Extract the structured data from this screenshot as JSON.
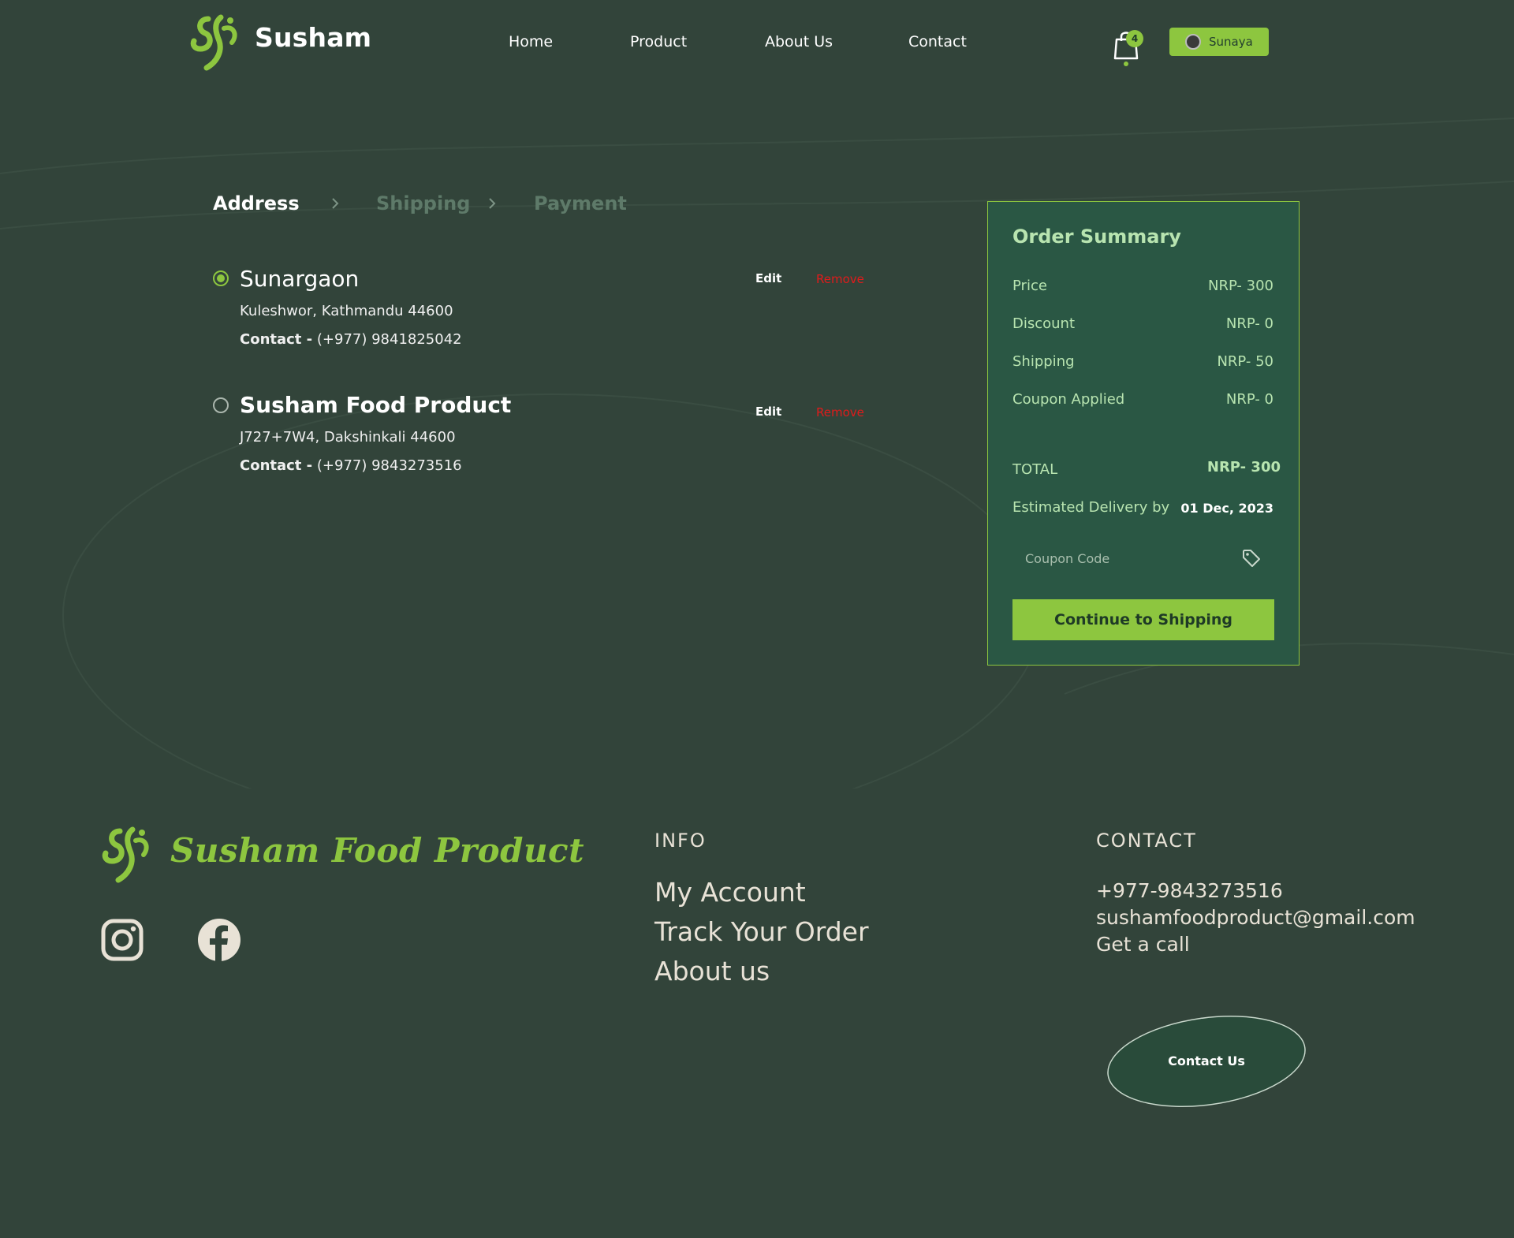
{
  "header": {
    "brand": "Susham",
    "nav": [
      "Home",
      "Product",
      "About Us",
      "Contact"
    ],
    "cart_count": "4",
    "cart_icon": "shopping-bag-icon",
    "user_name": "Sunaya"
  },
  "steps": [
    {
      "label": "Address",
      "active": true
    },
    {
      "label": "Shipping",
      "active": false
    },
    {
      "label": "Payment",
      "active": false
    }
  ],
  "addresses": [
    {
      "name": "Sunargaon",
      "line": "Kuleshwor, Kathmandu 44600",
      "contact_label": "Contact -",
      "contact_value": "(+977) 9841825042",
      "selected": true,
      "edit": "Edit",
      "remove": "Remove"
    },
    {
      "name": "Susham Food Product",
      "line": "J727+7W4, Dakshinkali 44600",
      "contact_label": "Contact -",
      "contact_value": "(+977) 9843273516",
      "selected": false,
      "edit": "Edit",
      "remove": "Remove"
    }
  ],
  "summary": {
    "title": "Order Summary",
    "rows": [
      {
        "label": "Price",
        "value": "NRP- 300"
      },
      {
        "label": "Discount",
        "value": "NRP- 0"
      },
      {
        "label": "Shipping",
        "value": "NRP- 50"
      },
      {
        "label": "Coupon Applied",
        "value": "NRP- 0"
      }
    ],
    "total_label": "TOTAL",
    "total_value": "NRP- 300",
    "delivery_label": "Estimated Delivery by",
    "delivery_value": "01 Dec, 2023",
    "coupon_placeholder": "Coupon Code",
    "continue_label": "Continue to Shipping"
  },
  "footer": {
    "brand": "Susham Food Product",
    "social": [
      "instagram-icon",
      "facebook-icon"
    ],
    "info_heading": "INFO",
    "info_links": [
      "My Account",
      "Track Your Order",
      "About us"
    ],
    "contact_heading": "CONTACT",
    "phone": "+977-9843273516",
    "email": "sushamfoodproduct@gmail.com",
    "call": "Get a call",
    "contact_button": "Contact Us"
  },
  "colors": {
    "background": "#32443a",
    "accent": "#8dc63f",
    "summary_bg": "#2a5744",
    "remove": "#e01b1b"
  }
}
